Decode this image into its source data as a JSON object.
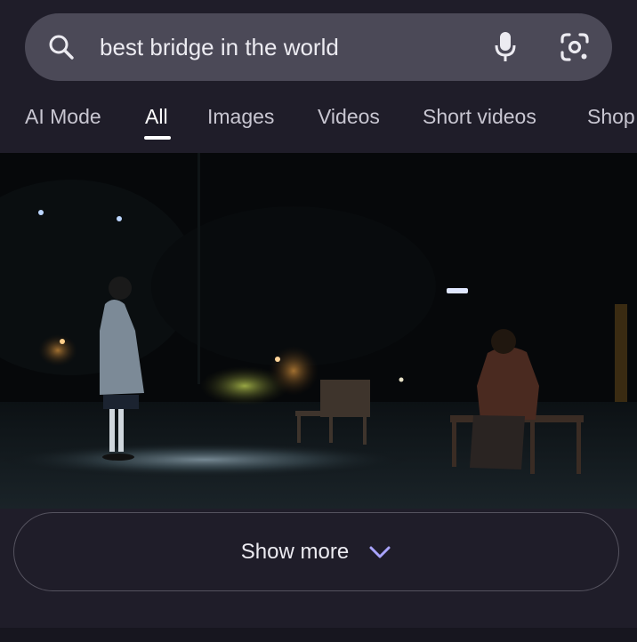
{
  "search": {
    "query": "best bridge in the world",
    "icons": {
      "search": "search-icon",
      "voice": "microphone-icon",
      "lens": "google-lens-icon"
    }
  },
  "tabs": [
    {
      "label": "AI Mode",
      "active": false
    },
    {
      "label": "All",
      "active": true
    },
    {
      "label": "Images",
      "active": false
    },
    {
      "label": "Videos",
      "active": false
    },
    {
      "label": "Short videos",
      "active": false
    },
    {
      "label": "Shop",
      "active": false
    }
  ],
  "result": {
    "show_more_label": "Show more",
    "show_more_icon": "chevron-down-icon"
  },
  "colors": {
    "background": "#1f1d29",
    "search_bar": "#4b4957",
    "accent": "#a9a4ff"
  }
}
